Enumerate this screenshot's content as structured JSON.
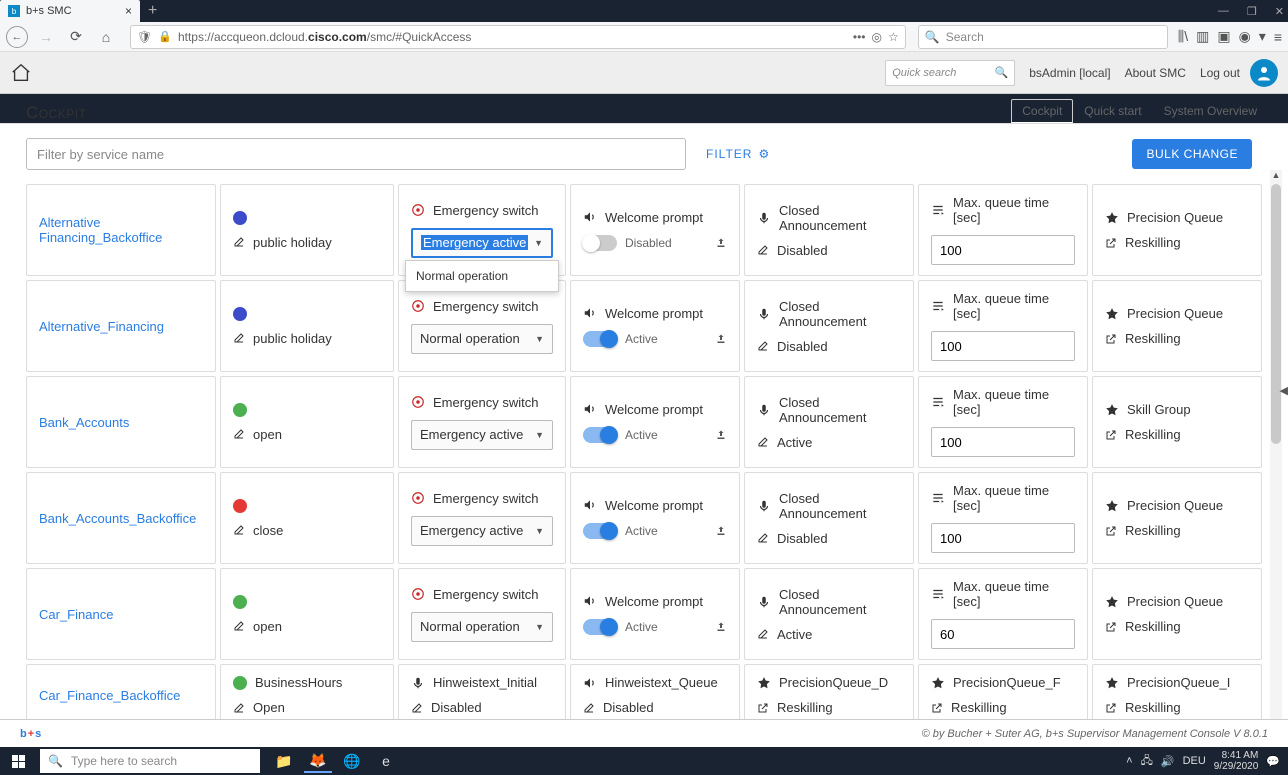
{
  "window": {
    "tab_title": "b+s SMC",
    "url_prefix": "https://accqueon.dcloud.",
    "url_bold": "cisco.com",
    "url_suffix": "/smc/#QuickAccess",
    "search_placeholder": "Search"
  },
  "app": {
    "quicksearch_placeholder": "Quick search",
    "user_label": "bsAdmin [local]",
    "about_label": "About SMC",
    "logout_label": "Log out",
    "page_title": "Cockpit",
    "tabs": {
      "cockpit": "Cockpit",
      "quickstart": "Quick start",
      "overview": "System Overview"
    },
    "filter_placeholder": "Filter by service name",
    "filter_label": "FILTER",
    "bulk_label": "BULK CHANGE"
  },
  "headers": {
    "emergency": "Emergency switch",
    "welcome": "Welcome prompt",
    "closed": "Closed Announcement",
    "queue": "Max. queue time [sec]",
    "precision": "Precision Queue",
    "skillgroup": "Skill Group",
    "reskilling": "Reskilling"
  },
  "labels": {
    "disabled": "Disabled",
    "active": "Active",
    "open": "open",
    "Open": "Open",
    "close": "close",
    "public_holiday": "public holiday",
    "normal_op": "Normal operation",
    "emerg_active": "Emergency active",
    "businesshours": "BusinessHours"
  },
  "rows": [
    {
      "name": "Alternative Financing_Backoffice",
      "status_color": "blue",
      "status_text": "public holiday",
      "emerg_value": "Emergency active",
      "emerg_open": true,
      "emerg_option": "Normal operation",
      "welcome_on": false,
      "welcome_state": "Disabled",
      "closed_state": "Disabled",
      "queue_val": "100",
      "skill_label": "Precision Queue"
    },
    {
      "name": "Alternative_Financing",
      "status_color": "blue",
      "status_text": "public holiday",
      "emerg_value": "Normal operation",
      "welcome_on": true,
      "welcome_state": "Active",
      "closed_state": "Disabled",
      "queue_val": "100",
      "skill_label": "Precision Queue"
    },
    {
      "name": "Bank_Accounts",
      "status_color": "green",
      "status_text": "open",
      "emerg_value": "Emergency active",
      "welcome_on": true,
      "welcome_state": "Active",
      "closed_state": "Active",
      "queue_val": "100",
      "skill_label": "Skill Group"
    },
    {
      "name": "Bank_Accounts_Backoffice",
      "status_color": "red",
      "status_text": "close",
      "emerg_value": "Emergency active",
      "welcome_on": true,
      "welcome_state": "Active",
      "closed_state": "Disabled",
      "queue_val": "100",
      "skill_label": "Precision Queue"
    },
    {
      "name": "Car_Finance",
      "status_color": "green",
      "status_text": "open",
      "emerg_value": "Normal operation",
      "welcome_on": true,
      "welcome_state": "Active",
      "closed_state": "Active",
      "queue_val": "60",
      "skill_label": "Precision Queue"
    }
  ],
  "row_cfb": {
    "name": "Car_Finance_Backoffice",
    "status_color": "green",
    "c1_top": "BusinessHours",
    "c1_bot": "Open",
    "c2_top": "Hinweistext_Initial",
    "c2_bot": "Disabled",
    "c3_top": "Hinweistext_Queue",
    "c3_bot": "Disabled",
    "c4_top": "PrecisionQueue_D",
    "c4_bot": "Reskilling",
    "c5_top": "PrecisionQueue_F",
    "c5_bot": "Reskilling",
    "c6_top": "PrecisionQueue_I",
    "c6_bot": "Reskilling"
  },
  "footer": {
    "copyright": "© by Bucher + Suter AG, b+s Supervisor Management Console V 8.0.1"
  },
  "taskbar": {
    "search_placeholder": "Type here to search",
    "lang": "DEU",
    "time": "8:41 AM",
    "date": "9/29/2020"
  }
}
